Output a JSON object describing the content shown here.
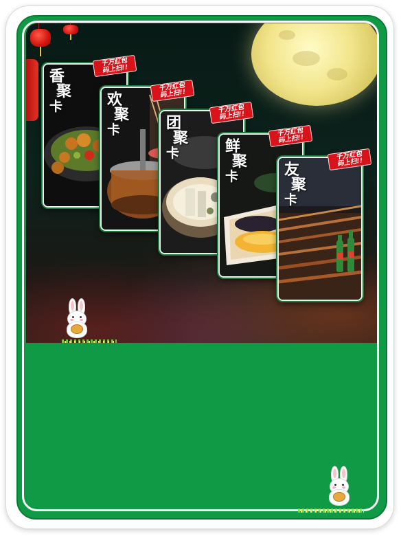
{
  "colors": {
    "frame_green": "#119a46",
    "promo_red": "#d8141a",
    "night_bg": "#0c221c",
    "moon_yellow": "#f2e58c"
  },
  "cards": [
    {
      "chars": [
        "香",
        "聚",
        "卡"
      ],
      "promo_line1": "千万红包",
      "promo_line2": "码上扫!!"
    },
    {
      "chars": [
        "欢",
        "聚",
        "卡"
      ],
      "promo_line1": "千万红包",
      "promo_line2": "码上扫!!"
    },
    {
      "chars": [
        "团",
        "聚",
        "卡"
      ],
      "promo_line1": "千万红包",
      "promo_line2": "码上扫!!"
    },
    {
      "chars": [
        "鲜",
        "聚",
        "卡"
      ],
      "promo_line1": "千万红包",
      "promo_line2": "码上扫!!"
    },
    {
      "chars": [
        "友",
        "聚",
        "卡"
      ],
      "promo_line1": "千万红包",
      "promo_line2": "码上扫!!"
    }
  ],
  "decorations": {
    "moon": "full-moon",
    "lanterns": "red-lantern-icon",
    "rabbits": "jade-rabbit-icon"
  }
}
